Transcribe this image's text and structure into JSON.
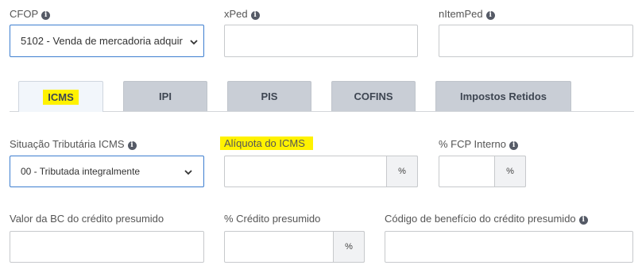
{
  "top_row": {
    "cfop": {
      "label": "CFOP",
      "value": "5102 - Venda de mercadoria adquir"
    },
    "xped": {
      "label": "xPed",
      "value": ""
    },
    "nitemped": {
      "label": "nItemPed",
      "value": ""
    }
  },
  "tabs": [
    {
      "label": "ICMS",
      "active": true
    },
    {
      "label": "IPI"
    },
    {
      "label": "PIS"
    },
    {
      "label": "COFINS"
    },
    {
      "label": "Impostos Retidos"
    }
  ],
  "icms": {
    "situacao": {
      "label": "Situação Tributária ICMS",
      "value": "00 - Tributada integralmente"
    },
    "aliquota": {
      "label": "Alíquota do ICMS",
      "value": "",
      "suffix": "%"
    },
    "fcp": {
      "label": "% FCP Interno",
      "value": "",
      "suffix": "%"
    },
    "bc_credito": {
      "label": "Valor da BC do crédito presumido",
      "value": ""
    },
    "credito_presumido": {
      "label": "% Crédito presumido",
      "value": "",
      "suffix": "%"
    },
    "codigo_beneficio": {
      "label": "Código de benefício do crédito presumido",
      "value": ""
    }
  },
  "info_icon_glyph": "i",
  "colors": {
    "highlight": "#fff200",
    "focus_border": "#3d7ed0",
    "tab_inactive": "#c9ced6",
    "tab_active": "#f2f6fb"
  }
}
